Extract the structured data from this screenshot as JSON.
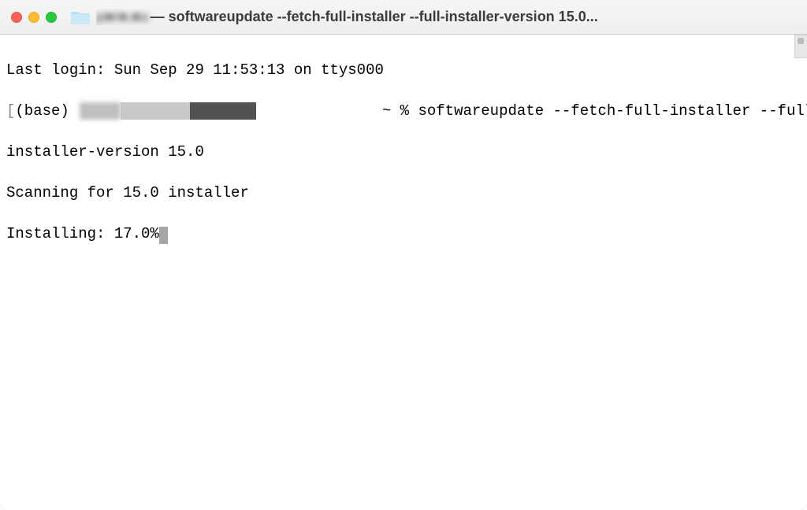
{
  "titlebar": {
    "title_prefix_redacted": "p■r■.■u",
    "title_rest": " — softwareupdate --fetch-full-installer --full-installer-version 15.0..."
  },
  "terminal": {
    "last_login": "Last login: Sun Sep 29 11:53:13 on ttys000",
    "prompt_open": "[",
    "prompt_env": "(base) ",
    "prompt_mid": "              ~ % ",
    "command_part1": "softwareupdate --fetch-full-installer --full-",
    "prompt_close": "]",
    "command_wrap": "installer-version 15.0",
    "scanning": "Scanning for 15.0 installer",
    "installing": "Installing: 17.0%"
  }
}
